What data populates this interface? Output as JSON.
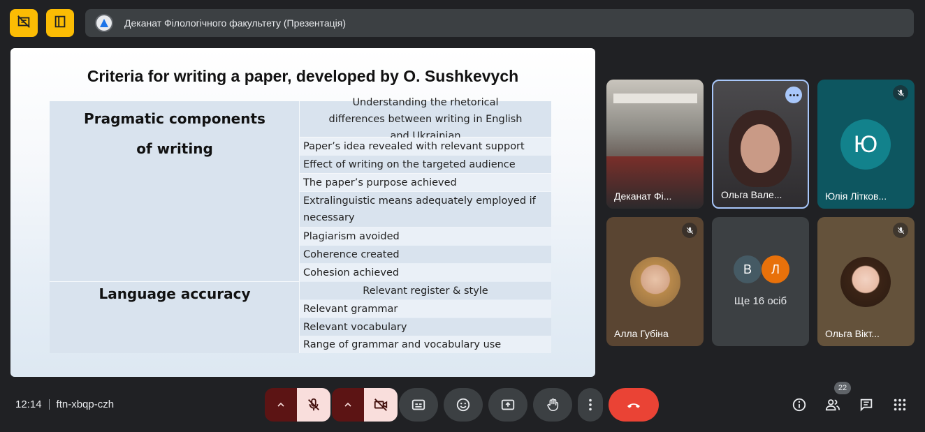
{
  "meeting": {
    "title": "Деканат Філологічного факультету (Презентація)",
    "time": "12:14",
    "code": "ftn-xbqp-czh",
    "participant_count": "22"
  },
  "slide": {
    "title": "Criteria for writing a paper, developed by O. Sushkevych",
    "group1_label_line1": "Pragmatic components",
    "group1_label_line2": "of writing",
    "group2_label": "Language accuracy",
    "rows": [
      "Understanding the rhetorical differences between writing in English and Ukrainian",
      "Paper’s idea revealed with relevant support",
      "Effect of writing on the targeted audience",
      "The paper’s purpose achieved",
      "Extralinguistic means adequately employed if necessary",
      "Plagiarism avoided",
      "Coherence created",
      "Cohesion achieved",
      "Relevant register & style",
      "Relevant grammar",
      "Relevant vocabulary",
      "Range of grammar and vocabulary use"
    ]
  },
  "participants": {
    "tile1_name": "Деканат Фі...",
    "tile2_name": "Ольга Вале...",
    "tile3_name": "Юлія Літков...",
    "tile3_initial": "Ю",
    "tile4_name": "Алла Губіна",
    "tile5_initial_a": "В",
    "tile5_initial_b": "Л",
    "tile5_more": "Ще 16 осіб",
    "tile6_name": "Ольга Вікт..."
  },
  "colors": {
    "accent_yellow": "#fbbc04",
    "end_call_red": "#ea4335",
    "active_tile_border": "#a8c7fa",
    "avatar_teal": "#12828c",
    "avatar_orange": "#e8710a"
  },
  "icons": {
    "top_left_1": "hide-tiles-icon",
    "top_left_2": "layout-icon",
    "controls": [
      "mic-off-icon",
      "camera-off-icon",
      "captions-icon",
      "emoji-icon",
      "present-screen-icon",
      "raise-hand-icon",
      "more-options-icon",
      "end-call-icon"
    ],
    "right": [
      "info-icon",
      "people-icon",
      "chat-icon",
      "activities-icon"
    ]
  }
}
